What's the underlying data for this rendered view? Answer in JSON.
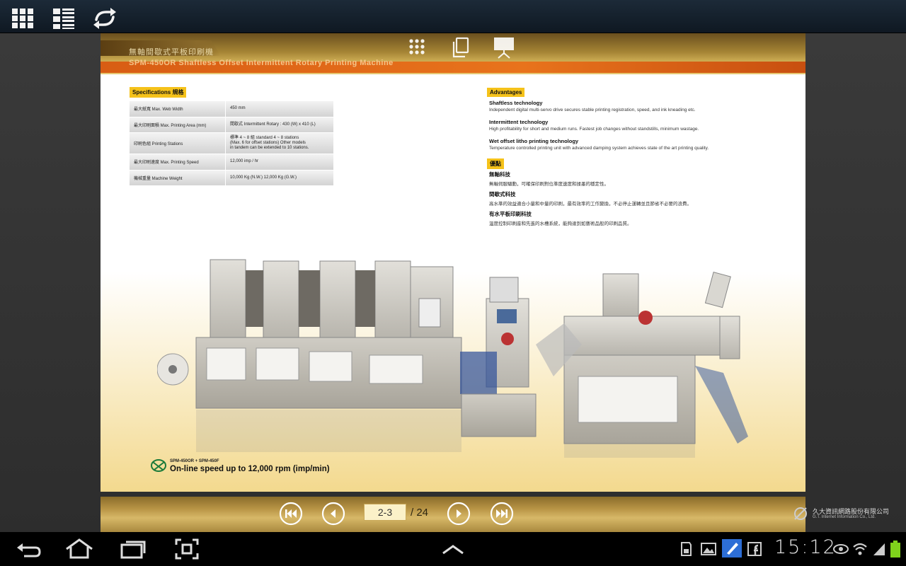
{
  "page": {
    "header_zh": "無軸間歇式平板印刷機",
    "header_en": "SPM-450OR Shaftless Offset Intermittent Rotary Printing Machine",
    "spec_title": "Specifications 規格",
    "specs": [
      {
        "key": "最大紙寬  Max. Web Width",
        "value": "450 mm"
      },
      {
        "key": "最大印刷面積  Max. Printing Area (mm)",
        "value": "間歇式  Intermittent Rotary : 430 (W) x 410 (L)"
      },
      {
        "key": "印刷色組  Printing Stations",
        "value": "標準 4 ~ 8 組  standard 4 ~ 8 stations\n(Max. 6 for offset stations) Other models\nin tandem can be extended to 10 stations."
      },
      {
        "key": "最大印刷速度  Max. Printing Speed",
        "value": "12,000 imp / hr"
      },
      {
        "key": "機械重量  Machine Weight",
        "value": "10,000 Kg (N.W.) 12,000 Kg (G.W.)"
      }
    ],
    "adv_title": "Advantages",
    "advantages": [
      {
        "h": "Shaftless technology",
        "d": "Independent digital multi-servo drive secures stable printing registration, speed, and ink kneading etc."
      },
      {
        "h": "Intermittent technology",
        "d": "High profitability for short and medium runs. Fastest job changes without standstills, minimum wastage."
      },
      {
        "h": "Wet offset litho printing technology",
        "d": "Temperature controlled printing unit with advanced damping system achieves state of the art printing quality."
      }
    ],
    "adv_zh_title": "優點",
    "advantages_zh": [
      {
        "h": "無軸科技",
        "d": "無軸伺服驅動，可確保印刷對位準度速度和揉墨的穩定性。"
      },
      {
        "h": "間歇式科技",
        "d": "高水準的效益適合小量和中量的印刷，最有效率的工作變換，不必停止運轉並且節省不必要的浪費。"
      },
      {
        "h": "有水平板印刷科技",
        "d": "溫度控制印刷座和先進的水槽系統，能夠達到如藝術品般的印刷品質。"
      }
    ],
    "caption_small": "SPM-450OR + SPM-450F",
    "caption_big": "On-line speed up to 12,000 rpm (imp/min)"
  },
  "nav": {
    "current_page": "2-3",
    "total": "/ 24"
  },
  "brand": {
    "name_zh": "久大資訊網路股份有限公司",
    "name_en": "G.T. Internet Information Co., Ltd."
  },
  "status": {
    "clock": "15:12"
  },
  "colors": {
    "accent_orange": "#e8731c",
    "gold": "#d7b868",
    "label_yellow": "#f5c21a"
  }
}
